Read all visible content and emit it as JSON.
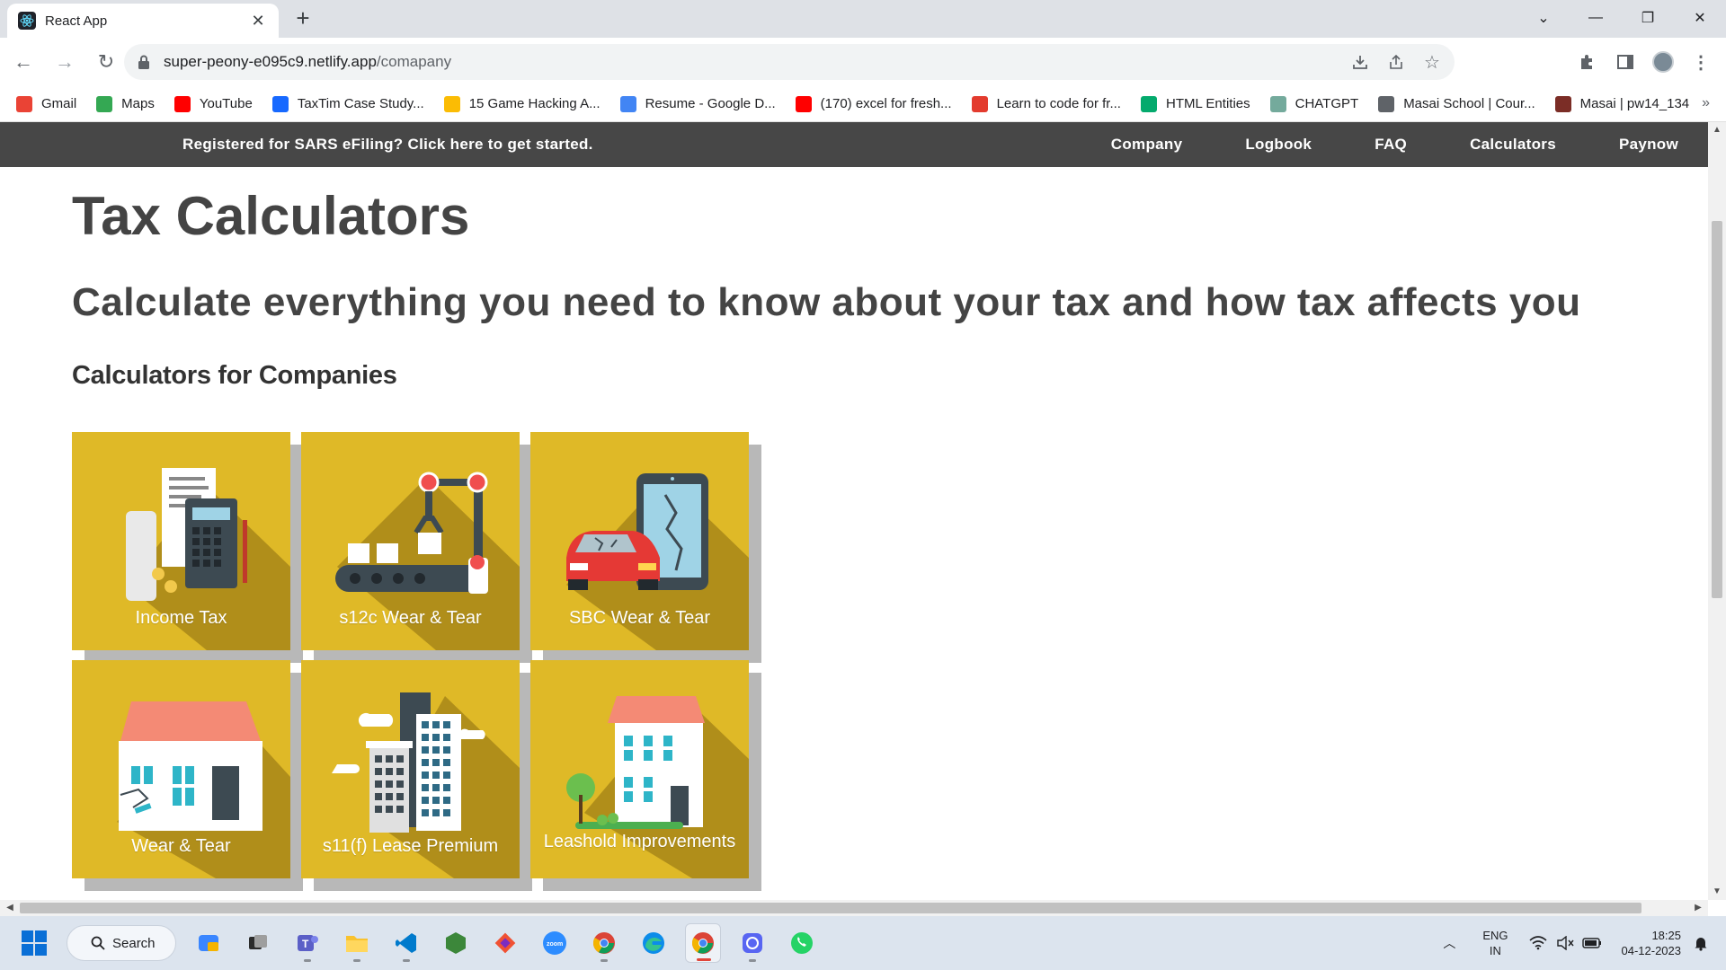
{
  "browser": {
    "tab_title": "React App",
    "url_domain": "super-peony-e095c9.netlify.app",
    "url_path": "/comapany"
  },
  "bookmarks": [
    {
      "label": "Gmail",
      "icon": "gmail-icon",
      "color": "#ea4335"
    },
    {
      "label": "Maps",
      "icon": "maps-icon",
      "color": "#34a853"
    },
    {
      "label": "YouTube",
      "icon": "youtube-icon",
      "color": "#ff0000"
    },
    {
      "label": "TaxTim Case Study...",
      "icon": "behance-icon",
      "color": "#1769ff"
    },
    {
      "label": "15 Game Hacking A...",
      "icon": "drive-icon",
      "color": "#fbbc04"
    },
    {
      "label": "Resume - Google D...",
      "icon": "docs-icon",
      "color": "#4285f4"
    },
    {
      "label": "(170) excel for fresh...",
      "icon": "youtube-icon",
      "color": "#ff0000"
    },
    {
      "label": "Learn to code for fr...",
      "icon": "codecademy-icon",
      "color": "#e33b2e"
    },
    {
      "label": "HTML Entities",
      "icon": "w3-icon",
      "color": "#04aa6d"
    },
    {
      "label": "CHATGPT",
      "icon": "chatgpt-icon",
      "color": "#74aa9c"
    },
    {
      "label": "Masai School | Cour...",
      "icon": "globe-icon",
      "color": "#5f6368"
    },
    {
      "label": "Masai | pw14_134",
      "icon": "masai-icon",
      "color": "#7b2d26"
    }
  ],
  "site_nav": {
    "cta": "Registered for SARS eFiling? Click here to get started.",
    "links": [
      "Company",
      "Logbook",
      "FAQ",
      "Calculators",
      "Paynow"
    ]
  },
  "page": {
    "title": "Tax Calculators",
    "subtitle": "Calculate everything you need to know about your tax and how tax affects you",
    "section": "Calculators for Companies"
  },
  "cards": [
    {
      "label": "Income Tax",
      "icon": "calculator-receipt-icon"
    },
    {
      "label": "s12c Wear & Tear",
      "icon": "robot-arm-icon"
    },
    {
      "label": "SBC Wear & Tear",
      "icon": "car-phone-icon"
    },
    {
      "label": "Wear & Tear",
      "icon": "house-icon"
    },
    {
      "label": "s11(f) Lease Premium",
      "icon": "buildings-icon"
    },
    {
      "label": "Leashold Improvements",
      "icon": "building-tree-icon"
    }
  ],
  "taskbar": {
    "search_label": "Search",
    "lang_line1": "ENG",
    "lang_line2": "IN",
    "time": "18:25",
    "date": "04-12-2023"
  },
  "colors": {
    "nav_bg": "#474747",
    "card_bg": "#dfb927",
    "card_shadow": "#b8b8b8"
  }
}
